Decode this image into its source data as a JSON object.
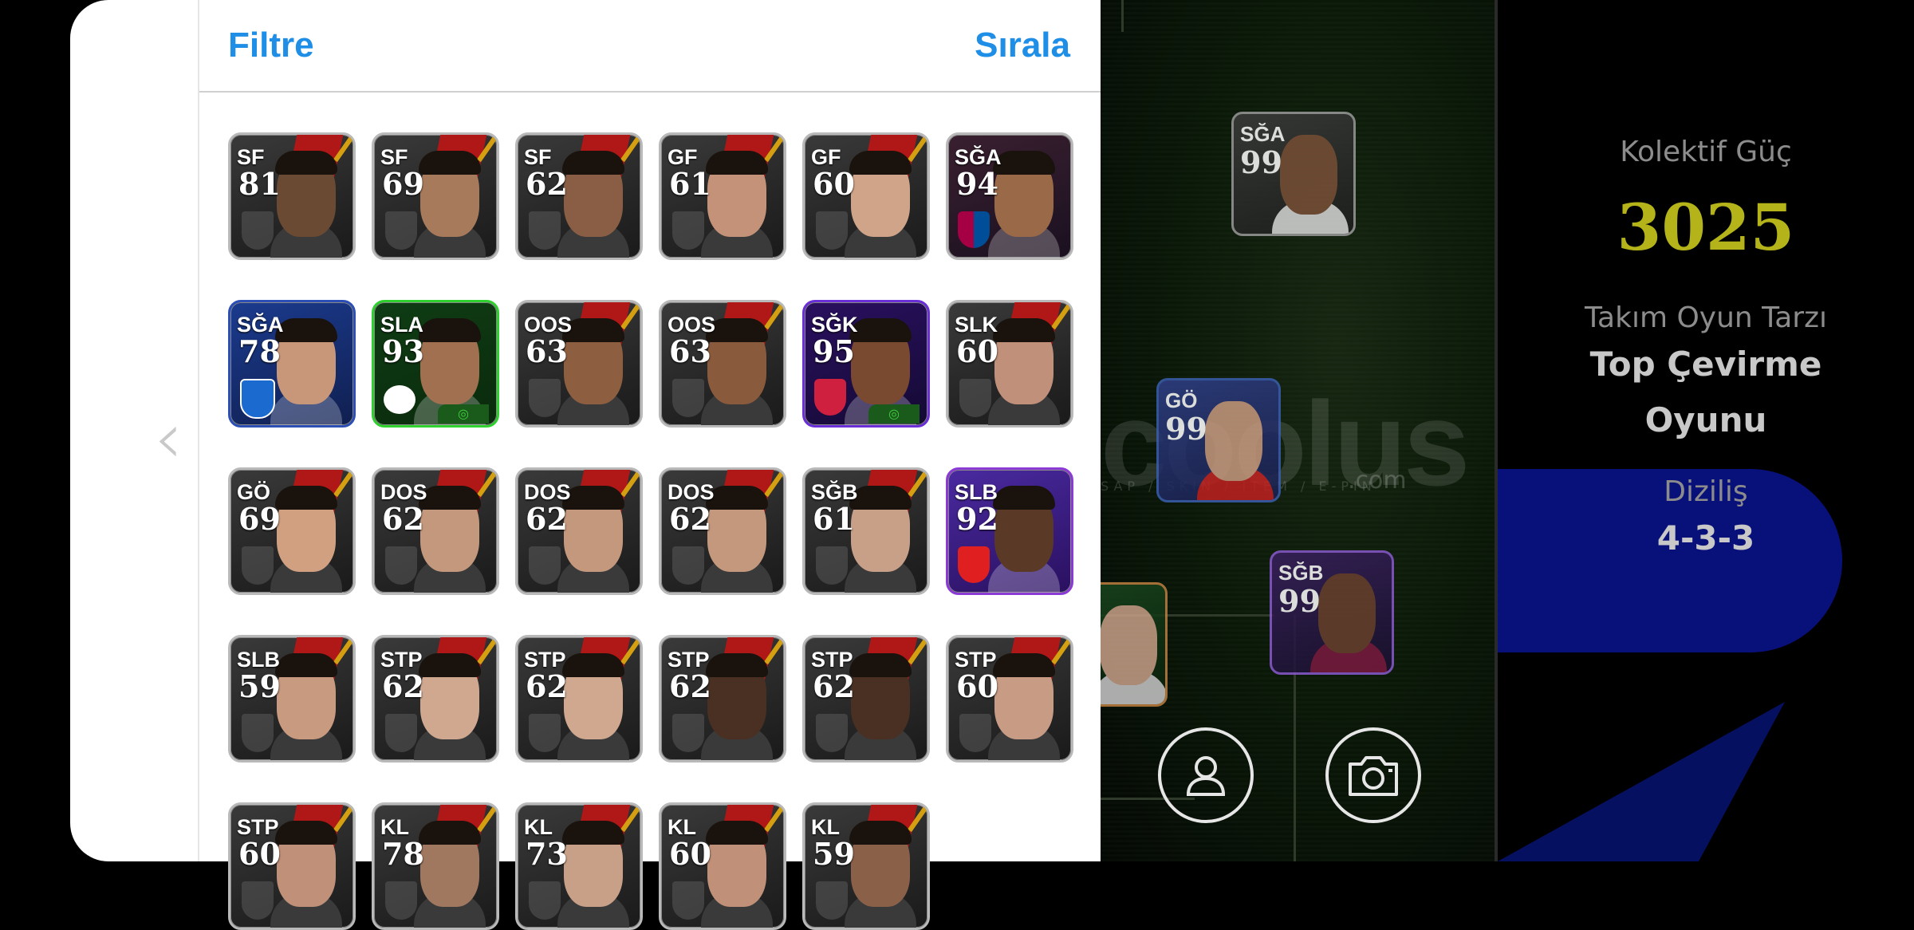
{
  "drawer": {
    "filter_label": "Filtre",
    "sort_label": "Sırala",
    "back_icon": "chevron-left-icon"
  },
  "players": [
    {
      "pos": "SF",
      "ovr": "81",
      "style": "",
      "skin": "#6b4a34"
    },
    {
      "pos": "SF",
      "ovr": "69",
      "style": "",
      "skin": "#a87a5c"
    },
    {
      "pos": "SF",
      "ovr": "62",
      "style": "",
      "skin": "#8a5e44"
    },
    {
      "pos": "GF",
      "ovr": "61",
      "style": "",
      "skin": "#c49278"
    },
    {
      "pos": "GF",
      "ovr": "60",
      "style": "",
      "skin": "#cfa488"
    },
    {
      "pos": "SĞA",
      "ovr": "94",
      "style": "barca",
      "skin": "#9a6a48"
    },
    {
      "pos": "SĞA",
      "ovr": "78",
      "style": "blue",
      "skin": "#c8977a"
    },
    {
      "pos": "SLA",
      "ovr": "93",
      "style": "green",
      "skin": "#a07050"
    },
    {
      "pos": "OOS",
      "ovr": "63",
      "style": "",
      "skin": "#8e5e40"
    },
    {
      "pos": "OOS",
      "ovr": "63",
      "style": "",
      "skin": "#8a5a3c"
    },
    {
      "pos": "SĞK",
      "ovr": "95",
      "style": "purple",
      "skin": "#7a4a30"
    },
    {
      "pos": "SLK",
      "ovr": "60",
      "style": "",
      "skin": "#c0907a"
    },
    {
      "pos": "GÖ",
      "ovr": "69",
      "style": "",
      "skin": "#d0a080"
    },
    {
      "pos": "DOS",
      "ovr": "62",
      "style": "",
      "skin": "#c4987c"
    },
    {
      "pos": "DOS",
      "ovr": "62",
      "style": "",
      "skin": "#c4987c"
    },
    {
      "pos": "DOS",
      "ovr": "62",
      "style": "",
      "skin": "#c4987c"
    },
    {
      "pos": "SĞB",
      "ovr": "61",
      "style": "",
      "skin": "#c8a088"
    },
    {
      "pos": "SLB",
      "ovr": "92",
      "style": "purple2",
      "skin": "#5a3a26"
    },
    {
      "pos": "SLB",
      "ovr": "59",
      "style": "",
      "skin": "#c89a80"
    },
    {
      "pos": "STP",
      "ovr": "62",
      "style": "",
      "skin": "#d0a890"
    },
    {
      "pos": "STP",
      "ovr": "62",
      "style": "",
      "skin": "#d0a890"
    },
    {
      "pos": "STP",
      "ovr": "62",
      "style": "",
      "skin": "#4a3022"
    },
    {
      "pos": "STP",
      "ovr": "62",
      "style": "",
      "skin": "#4a3022"
    },
    {
      "pos": "STP",
      "ovr": "60",
      "style": "",
      "skin": "#c89c84"
    },
    {
      "pos": "STP",
      "ovr": "60",
      "style": "",
      "skin": "#c09078"
    },
    {
      "pos": "KL",
      "ovr": "78",
      "style": "",
      "skin": "#a07860"
    },
    {
      "pos": "KL",
      "ovr": "73",
      "style": "",
      "skin": "#c8a088"
    },
    {
      "pos": "KL",
      "ovr": "60",
      "style": "",
      "skin": "#c09078"
    },
    {
      "pos": "KL",
      "ovr": "59",
      "style": "",
      "skin": "#8a6048"
    }
  ],
  "pitch_cards": [
    {
      "pos": "SĞA",
      "ovr": "99",
      "skin": "#7a5038"
    },
    {
      "pos": "GÖ",
      "ovr": "99",
      "skin": "#c89a80"
    },
    {
      "pos": "SĞB",
      "ovr": "99",
      "skin": "#6a4030"
    }
  ],
  "stats": {
    "power_label": "Kolektif Güç",
    "power_value": "3025",
    "style_label": "Takım Oyun Tarzı",
    "style_value_1": "Top Çevirme",
    "style_value_2": "Oyunu",
    "formation_label": "Diziliş",
    "formation_value": "4-3-3"
  },
  "buttons": {
    "profile_icon": "user-icon",
    "camera_icon": "camera-icon"
  },
  "colors": {
    "accent": "#1e8ee6",
    "power": "#b4b41a",
    "panel_blue": "#08107a"
  }
}
